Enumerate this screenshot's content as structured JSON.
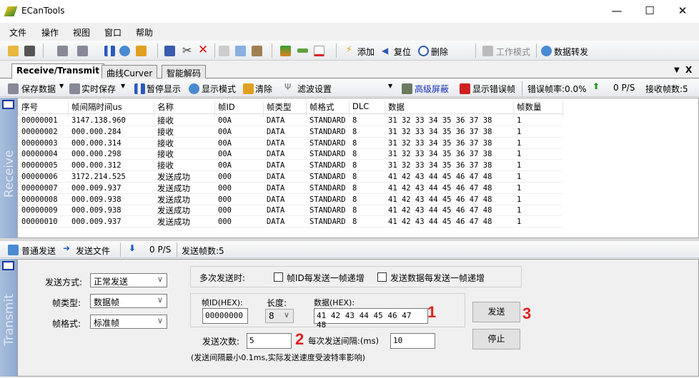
{
  "window": {
    "title": "ECanTools",
    "minimize": "—",
    "maximize": "☐",
    "close": "✕"
  },
  "menu": [
    "文件",
    "操作",
    "视图",
    "窗口",
    "帮助"
  ],
  "toolbar": {
    "add": "添加",
    "reset": "复位",
    "delete": "删除",
    "work_mode": "工作模式",
    "data_forward": "数据转发"
  },
  "tabs": [
    {
      "label": "Receive/Transmit"
    },
    {
      "label": "曲线Curver"
    },
    {
      "label": "智能解码"
    }
  ],
  "tab_controls": {
    "dropdown": "▼",
    "close": "X"
  },
  "recv_toolbar": {
    "save_data": "保存数据",
    "realtime_save": "实时保存",
    "pause": "暂停显示",
    "display_mode": "显示模式",
    "clear": "清除",
    "filter": "滤波设置",
    "advanced_mask": "高级屏蔽",
    "show_error": "显示错误帧",
    "error_rate": "错误帧率:0.0%",
    "rate": "0 P/S",
    "recv_count": "接收帧数:5"
  },
  "receive": {
    "side_label": "Receive",
    "columns": [
      "序号",
      "帧间隔时间us",
      "名称",
      "帧ID",
      "帧类型",
      "帧格式",
      "DLC",
      "数据",
      "帧数量"
    ],
    "rows": [
      [
        "00000001",
        "3147.138.960",
        "接收",
        "00A",
        "DATA",
        "STANDARD",
        "8",
        "31 32 33 34 35 36 37 38",
        "1"
      ],
      [
        "00000002",
        "000.000.284",
        "接收",
        "00A",
        "DATA",
        "STANDARD",
        "8",
        "31 32 33 34 35 36 37 38",
        "1"
      ],
      [
        "00000003",
        "000.000.314",
        "接收",
        "00A",
        "DATA",
        "STANDARD",
        "8",
        "31 32 33 34 35 36 37 38",
        "1"
      ],
      [
        "00000004",
        "000.000.298",
        "接收",
        "00A",
        "DATA",
        "STANDARD",
        "8",
        "31 32 33 34 35 36 37 38",
        "1"
      ],
      [
        "00000005",
        "000.000.312",
        "接收",
        "00A",
        "DATA",
        "STANDARD",
        "8",
        "31 32 33 34 35 36 37 38",
        "1"
      ],
      [
        "00000006",
        "3172.214.525",
        "发送成功",
        "000",
        "DATA",
        "STANDARD",
        "8",
        "41 42 43 44 45 46 47 48",
        "1"
      ],
      [
        "00000007",
        "000.009.937",
        "发送成功",
        "000",
        "DATA",
        "STANDARD",
        "8",
        "41 42 43 44 45 46 47 48",
        "1"
      ],
      [
        "00000008",
        "000.009.938",
        "发送成功",
        "000",
        "DATA",
        "STANDARD",
        "8",
        "41 42 43 44 45 46 47 48",
        "1"
      ],
      [
        "00000009",
        "000.009.938",
        "发送成功",
        "000",
        "DATA",
        "STANDARD",
        "8",
        "41 42 43 44 45 46 47 48",
        "1"
      ],
      [
        "00000010",
        "000.009.937",
        "发送成功",
        "000",
        "DATA",
        "STANDARD",
        "8",
        "41 42 43 44 45 46 47 48",
        "1"
      ]
    ]
  },
  "send_toolbar": {
    "normal_send": "普通发送",
    "send_file": "发送文件",
    "rate": "0 P/S",
    "send_count": "发送帧数:5"
  },
  "transmit": {
    "side_label": "Transmit",
    "send_mode_label": "发送方式:",
    "send_mode": "正常发送",
    "frame_type_label": "帧类型:",
    "frame_type": "数据帧",
    "frame_format_label": "帧格式:",
    "frame_format": "标准帧",
    "multi_label": "多次发送时:",
    "inc_id": "帧ID每发送一帧递增",
    "inc_data": "发送数据每发送一帧递增",
    "frame_id_label": "帧ID(HEX):",
    "frame_id": "00000000",
    "length_label": "长度:",
    "length": "8",
    "data_label": "数据(HEX):",
    "data": "41 42 43 44 45 46 47 48",
    "count_label": "发送次数:",
    "count": "5",
    "interval_label": "每次发送间隔:(ms)",
    "interval": "10",
    "note": "(发送间隔最小0.1ms,实际发送速度受波特率影响)",
    "send_button": "发送",
    "stop_button": "停止",
    "annotations": [
      "1",
      "2",
      "3"
    ]
  }
}
